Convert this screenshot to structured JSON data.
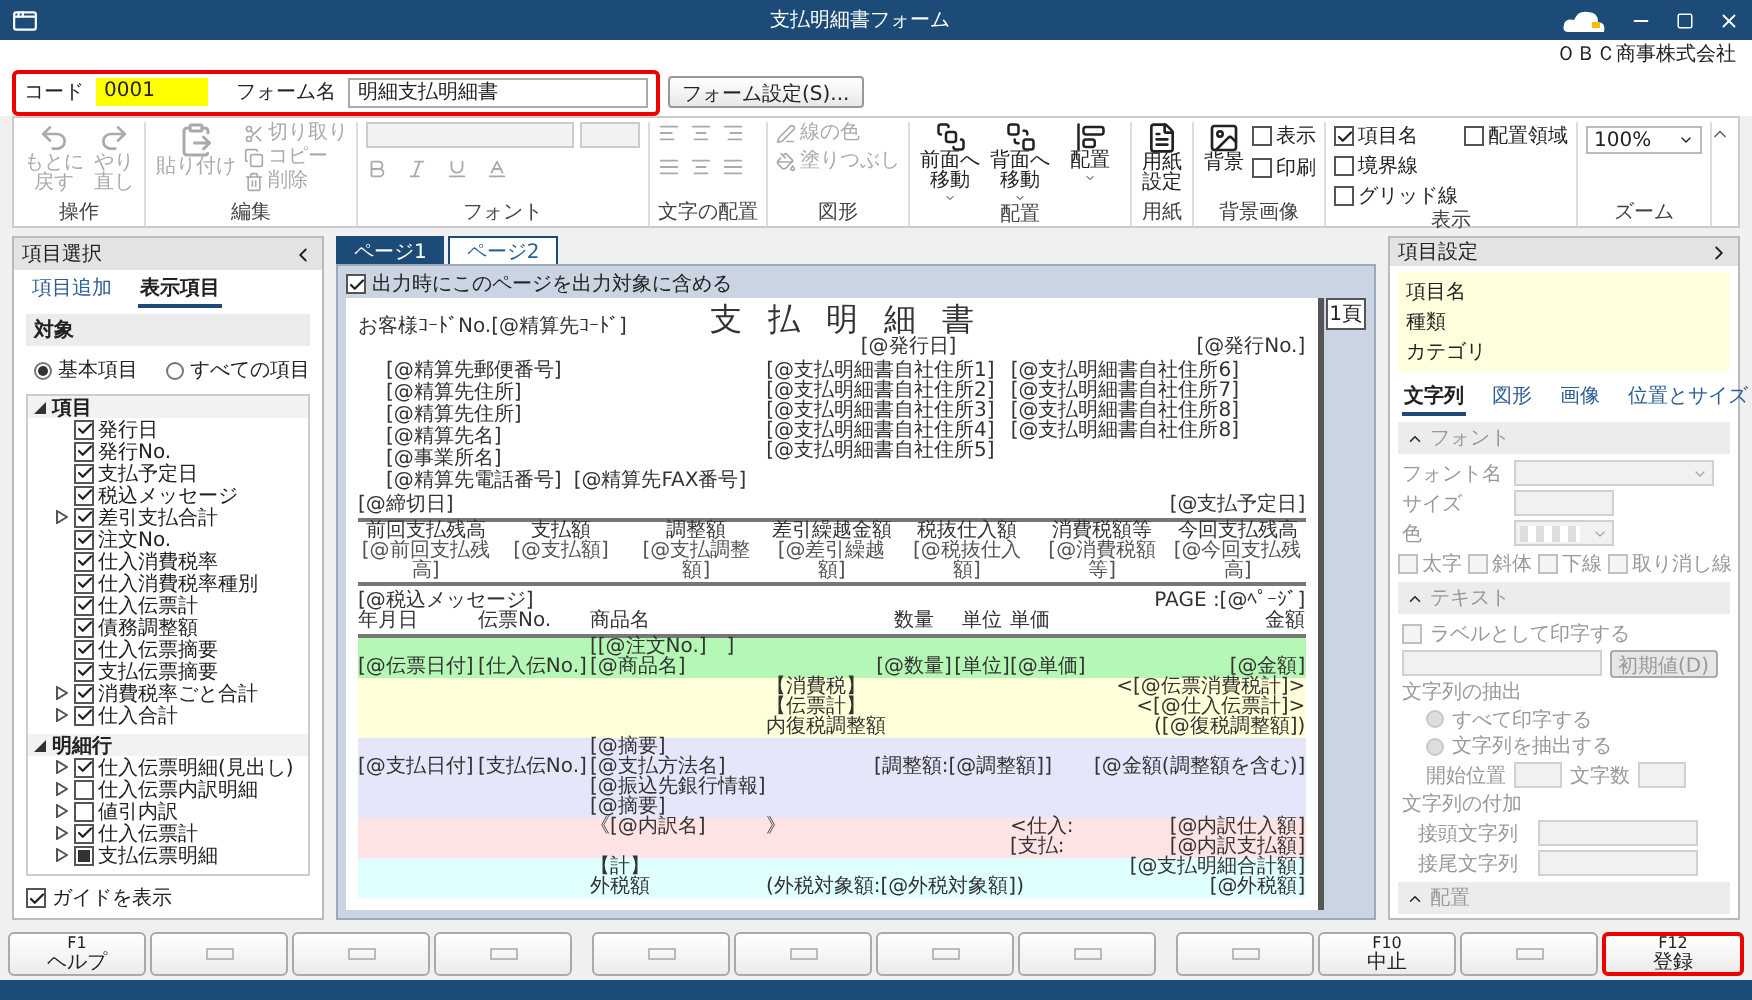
{
  "window": {
    "title": "支払明細書フォーム",
    "company": "ＯＢＣ商事株式会社"
  },
  "form_header": {
    "highlighted": true,
    "code_label": "コード",
    "code": "0001",
    "name_label": "フォーム名",
    "name": "明細支払明細書",
    "settings_button": "フォーム設定(S)..."
  },
  "ribbon": {
    "groups": [
      {
        "kind": "history",
        "label": "操作",
        "buttons": [
          {
            "label": "もとに戻す",
            "disabled": true
          },
          {
            "label": "やり直し",
            "disabled": true
          }
        ]
      },
      {
        "kind": "edit",
        "label": "編集",
        "buttons": [
          {
            "label": "貼り付け",
            "disabled": true
          },
          {
            "label": "切り取り",
            "disabled": true
          },
          {
            "label": "コピー",
            "disabled": true
          },
          {
            "label": "削除",
            "disabled": true
          }
        ]
      },
      {
        "kind": "font",
        "label": "フォント",
        "disabled": true
      },
      {
        "kind": "align",
        "label": "文字の配置",
        "disabled": true
      },
      {
        "kind": "shape",
        "label": "図形",
        "buttons": [
          {
            "label": "線の色",
            "disabled": true
          },
          {
            "label": "塗りつぶし",
            "disabled": true
          }
        ]
      },
      {
        "kind": "arrange",
        "label": "配置",
        "buttons": [
          {
            "label": "前面へ移動",
            "disabled": false
          },
          {
            "label": "背面へ移動",
            "disabled": false
          },
          {
            "label": "配置",
            "disabled": false
          }
        ]
      },
      {
        "kind": "paper",
        "label": "用紙",
        "buttons": [
          {
            "label": "用紙設定",
            "disabled": false
          }
        ]
      },
      {
        "kind": "background",
        "label": "背景画像",
        "buttons": [
          {
            "label": "背景",
            "disabled": false
          }
        ],
        "checks": [
          {
            "label": "表示",
            "checked": false
          },
          {
            "label": "印刷",
            "checked": false
          }
        ]
      },
      {
        "kind": "view",
        "label": "表示",
        "checks": [
          {
            "label": "項目名",
            "checked": true
          },
          {
            "label": "境界線",
            "checked": false
          },
          {
            "label": "グリッド線",
            "checked": false
          },
          {
            "label": "配置領域",
            "checked": false
          }
        ]
      },
      {
        "kind": "zoom",
        "label": "ズーム",
        "value": "100%"
      }
    ]
  },
  "item_panel": {
    "title": "項目選択",
    "tabs": [
      {
        "label": "項目追加",
        "selected": false
      },
      {
        "label": "表示項目",
        "selected": true
      }
    ],
    "section": "対象",
    "scopes": [
      {
        "label": "基本項目",
        "selected": true
      },
      {
        "label": "すべての項目",
        "selected": false
      }
    ],
    "tree": [
      {
        "label": "項目",
        "expanded": true,
        "children": [
          {
            "label": "発行日",
            "kind": "leaf",
            "checked": true,
            "indeterminate": false
          },
          {
            "label": "発行No.",
            "kind": "leaf",
            "checked": true,
            "indeterminate": false
          },
          {
            "label": "支払予定日",
            "kind": "leaf",
            "checked": true,
            "indeterminate": false
          },
          {
            "label": "税込メッセージ",
            "kind": "leaf",
            "checked": true,
            "indeterminate": false
          },
          {
            "label": "差引支払合計",
            "kind": "branch",
            "expanded": false,
            "checked": true,
            "indeterminate": false
          },
          {
            "label": "注文No.",
            "kind": "leaf",
            "checked": true,
            "indeterminate": false
          },
          {
            "label": "仕入消費税率",
            "kind": "leaf",
            "checked": true,
            "indeterminate": false
          },
          {
            "label": "仕入消費税率種別",
            "kind": "leaf",
            "checked": true,
            "indeterminate": false
          },
          {
            "label": "仕入伝票計",
            "kind": "leaf",
            "checked": true,
            "indeterminate": false
          },
          {
            "label": "債務調整額",
            "kind": "leaf",
            "checked": true,
            "indeterminate": false
          },
          {
            "label": "仕入伝票摘要",
            "kind": "leaf",
            "checked": true,
            "indeterminate": false
          },
          {
            "label": "支払伝票摘要",
            "kind": "leaf",
            "checked": true,
            "indeterminate": false
          },
          {
            "label": "消費税率ごと合計",
            "kind": "branch",
            "expanded": false,
            "checked": true,
            "indeterminate": false
          },
          {
            "label": "仕入合計",
            "kind": "branch",
            "expanded": false,
            "checked": true,
            "indeterminate": false
          }
        ]
      },
      {
        "label": "明細行",
        "expanded": true,
        "children": [
          {
            "label": "仕入伝票明細(見出し)",
            "kind": "branch",
            "expanded": false,
            "checked": true,
            "indeterminate": false
          },
          {
            "label": "仕入伝票内訳明細",
            "kind": "branch",
            "expanded": false,
            "checked": false,
            "indeterminate": false
          },
          {
            "label": "値引内訳",
            "kind": "branch",
            "expanded": false,
            "checked": false,
            "indeterminate": false
          },
          {
            "label": "仕入伝票計",
            "kind": "branch",
            "expanded": false,
            "checked": true,
            "indeterminate": false
          },
          {
            "label": "支払伝票明細",
            "kind": "branch",
            "expanded": false,
            "checked": false,
            "indeterminate": true
          }
        ]
      }
    ],
    "guide": {
      "label": "ガイドを表示",
      "checked": true
    }
  },
  "preview": {
    "tabs": [
      {
        "label": "ページ1",
        "selected": true
      },
      {
        "label": "ページ2",
        "selected": false
      }
    ],
    "include_check": {
      "label": "出力時にこのページを出力対象に含める",
      "checked": true
    },
    "page_marker": "1頁",
    "document": {
      "customer_code": "お客様ｺｰﾄﾞNo.[@精算先ｺｰﾄﾞ]",
      "title": "支 払 明 細 書",
      "issue_date": "[@発行日]",
      "issue_no": "[@発行No.]",
      "recipient_fields": [
        "[@精算先郵便番号]",
        "[@精算先住所]",
        "[@精算先住所]",
        "[@精算先名]",
        "[@事業所名]"
      ],
      "phone": "[@精算先電話番号]",
      "fax": "[@精算先FAX番号]",
      "company_addresses": [
        "[@支払明細書自社住所1]",
        "[@支払明細書自社住所2]",
        "[@支払明細書自社住所3]",
        "[@支払明細書自社住所4]",
        "[@支払明細書自社住所5]",
        "[@支払明細書自社住所6]",
        "[@支払明細書自社住所7]",
        "[@支払明細書自社住所8]",
        "[@支払明細書自社住所8]"
      ],
      "payment_date": "[@支払予定日]",
      "closing_date": "[@締切日]",
      "summary": [
        {
          "label": "前回支払残高",
          "field": "[@前回支払残高]"
        },
        {
          "label": "支払額",
          "field": "[@支払額]"
        },
        {
          "label": "調整額",
          "field": "[@支払調整額]"
        },
        {
          "label": "差引繰越金額",
          "field": "[@差引繰越額]"
        },
        {
          "label": "税抜仕入額",
          "field": "[@税抜仕入額]"
        },
        {
          "label": "消費税額等",
          "field": "[@消費税額等]"
        },
        {
          "label": "今回支払残高",
          "field": "[@今回支払残高]"
        }
      ],
      "tax_message": "[@税込メッセージ]",
      "page": "PAGE :[@ﾍﾟｰｼﾞ]",
      "columns": [
        {
          "kind": "date",
          "label": "年月日"
        },
        {
          "kind": "slip",
          "label": "伝票No."
        },
        {
          "kind": "name",
          "label": "商品名"
        },
        {
          "kind": "qty",
          "label": "数量"
        },
        {
          "kind": "unit",
          "label": "単位"
        },
        {
          "kind": "price",
          "label": "単価"
        },
        {
          "kind": "amount",
          "label": "金額"
        }
      ],
      "bands": [
        {
          "color": "#b5f7b5",
          "rows": [
            {
              "name": "[[@注文No.]　]"
            },
            {
              "date": "[@伝票日付]",
              "slip": "[仕入伝No.]",
              "name": "[@商品名]",
              "qty": "[@数量]",
              "unit": "[単位]",
              "price": "[@単価]",
              "amount": "[@金額]"
            }
          ]
        },
        {
          "color": "#ffffd9",
          "rows": [
            {
              "mid": "【消費税】",
              "amount": "<[@伝票消費税計]>"
            },
            {
              "mid": "【伝票計】",
              "amount": "<[@仕入伝票計]>"
            },
            {
              "mid_wide": "内復税調整額",
              "amount": "([@復税調整額])"
            }
          ]
        },
        {
          "color": "#e6e6fb",
          "rows": [
            {
              "name": "[@摘要]"
            },
            {
              "date": "[@支払日付]",
              "slip": "[支払伝No.]",
              "name": "[@支払方法名]",
              "adjust": "[調整額:[@調整額]]",
              "amount": "[@金額(調整額を含む)]"
            },
            {
              "name": "[@振込先銀行情報]"
            },
            {
              "name": "[@摘要]"
            }
          ]
        },
        {
          "color": "#fde3e3",
          "rows": [
            {
              "name": "《[@内訳名]",
              "mid": "》",
              "price": "<仕入:",
              "amount": "[@内訳仕入額]"
            },
            {
              "price": "[支払:",
              "amount": "[@内訳支払額]"
            }
          ]
        },
        {
          "color": "#e0ffff",
          "rows": [
            {
              "name": "【計】",
              "amount": "[@支払明細合計額]"
            },
            {
              "name": "外税額",
              "mid_wide": "(外税対象額:[@外税対象額])",
              "amount": "[@外税額]"
            }
          ]
        }
      ]
    }
  },
  "properties": {
    "title": "項目設定",
    "disabled": true,
    "info": [
      "項目名",
      "種類",
      "カテゴリ"
    ],
    "tabs": [
      {
        "label": "文字列",
        "selected": true
      },
      {
        "label": "図形",
        "selected": false
      },
      {
        "label": "画像",
        "selected": false
      },
      {
        "label": "位置とサイズ",
        "selected": false
      }
    ],
    "font_section": {
      "title": "フォント",
      "fields": [
        {
          "label": "フォント名",
          "kind": "select"
        },
        {
          "label": "サイズ",
          "kind": "input"
        },
        {
          "label": "色",
          "kind": "color"
        }
      ],
      "styles": [
        {
          "label": "太字",
          "checked": false
        },
        {
          "label": "斜体",
          "checked": false
        },
        {
          "label": "下線",
          "checked": false
        },
        {
          "label": "取り消し線",
          "checked": false
        }
      ]
    },
    "text_section": {
      "title": "テキスト",
      "label_check": {
        "label": "ラベルとして印字する",
        "checked": false
      },
      "default_button": "初期値(D)",
      "extract_title": "文字列の抽出",
      "extract_options": [
        {
          "label": "すべて印字する",
          "selected": false
        },
        {
          "label": "文字列を抽出する",
          "selected": false
        }
      ],
      "start_label": "開始位置",
      "count_label": "文字数",
      "affix_title": "文字列の付加",
      "affixes": [
        "接頭文字列",
        "接尾文字列"
      ]
    },
    "align_section": {
      "title": "配置"
    }
  },
  "function_keys": [
    {
      "key": "F1",
      "label": "ヘルプ",
      "highlighted": false
    },
    {
      "highlighted": false
    },
    {
      "highlighted": false
    },
    {
      "highlighted": false
    },
    {
      "highlighted": false
    },
    {
      "highlighted": false
    },
    {
      "highlighted": false
    },
    {
      "highlighted": false
    },
    {
      "highlighted": false
    },
    {
      "key": "F10",
      "label": "中止",
      "highlighted": false
    },
    {
      "highlighted": false
    },
    {
      "key": "F12",
      "label": "登録",
      "highlighted": true
    }
  ]
}
